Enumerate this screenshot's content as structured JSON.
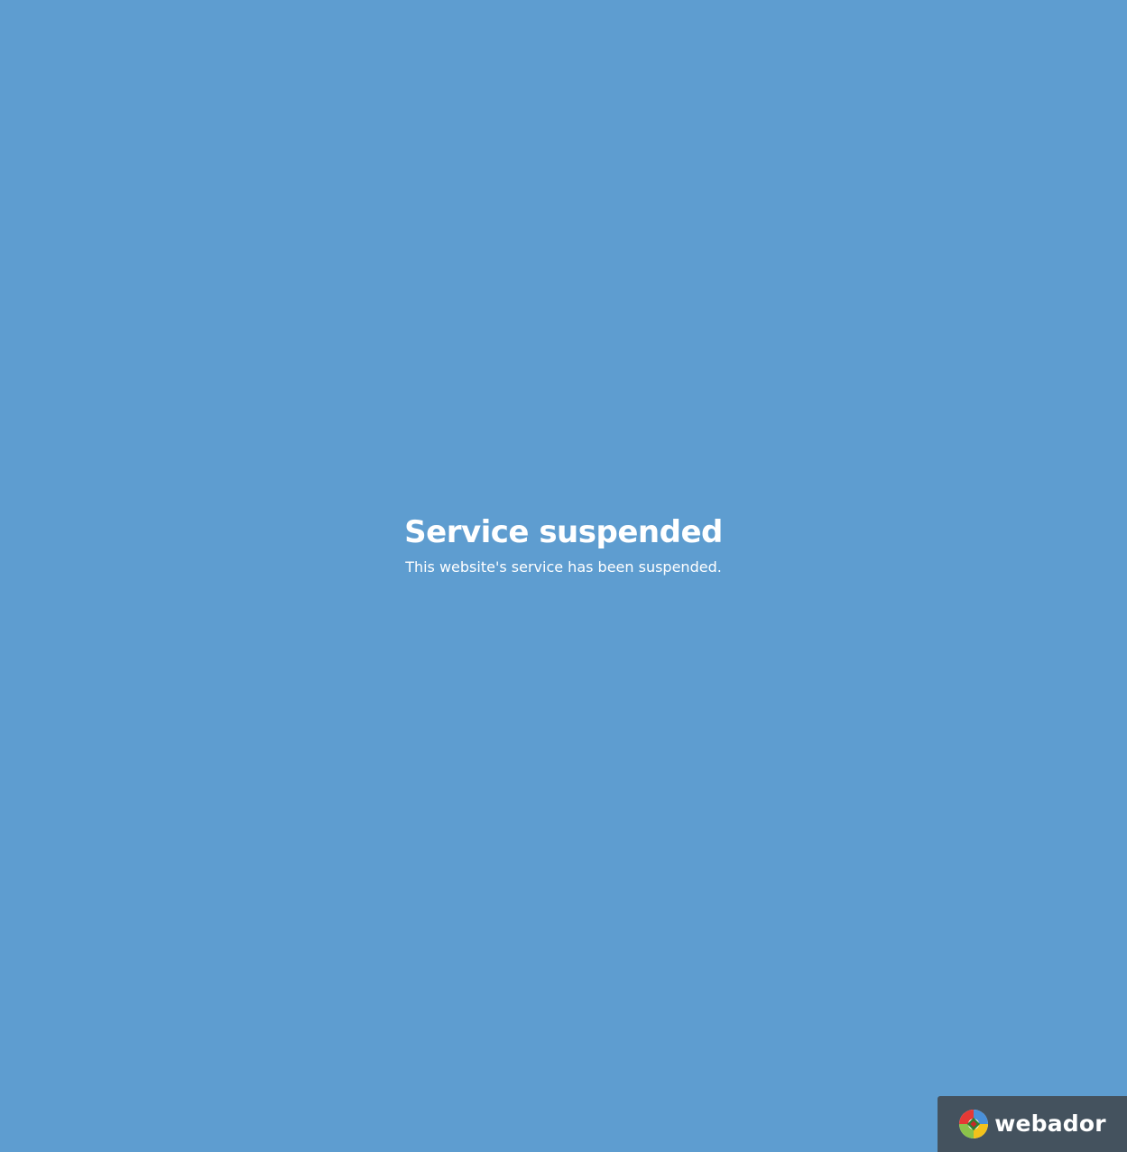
{
  "page": {
    "background_color": "#5e9dd0",
    "text_color": "#ffffff"
  },
  "message": {
    "title": "Service suspended",
    "subtitle": "This website's service has been suspended."
  },
  "badge": {
    "brand_name": "webador",
    "background_color": "#44525e",
    "logo_icon": "webador-logo-icon"
  }
}
